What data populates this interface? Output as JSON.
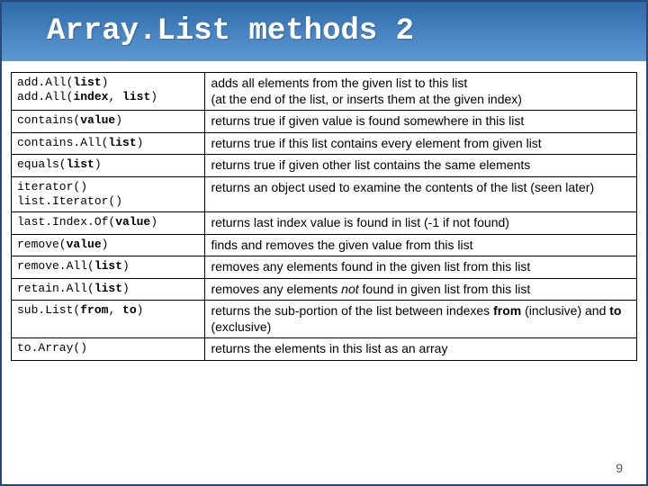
{
  "title_part1": "Array.List",
  "title_part2": " methods 2",
  "page_number": "9",
  "rows": [
    {
      "sig_html": "add.All(<b>list</b>)<br>add.All(<b>index</b>, <b>list</b>)",
      "desc_html": "adds all elements from the given list to this list<br>(at the end of the list, or inserts them at the given index)"
    },
    {
      "sig_html": "contains(<b>value</b>)",
      "desc_html": "returns true if given value is found somewhere in this list"
    },
    {
      "sig_html": "contains.All(<b>list</b>)",
      "desc_html": "returns true if this list contains every element from given list"
    },
    {
      "sig_html": "equals(<b>list</b>)",
      "desc_html": "returns true if given other list contains the same elements"
    },
    {
      "sig_html": "iterator()<br>list.Iterator()",
      "desc_html": "returns an object used to examine the contents of the list (seen later)"
    },
    {
      "sig_html": "last.Index.Of(<b>value</b>)",
      "desc_html": "returns last index value is found in list (-1 if not found)"
    },
    {
      "sig_html": "remove(<b>value</b>)",
      "desc_html": "finds and removes the given value from this list"
    },
    {
      "sig_html": "remove.All(<b>list</b>)",
      "desc_html": "removes any elements found in the given list from this list"
    },
    {
      "sig_html": "retain.All(<b>list</b>)",
      "desc_html": "removes any elements <em class='not'>not</em> found in given list from this list"
    },
    {
      "sig_html": "sub.List(<b>from</b>, <b>to</b>)",
      "desc_html": "returns the sub-portion of the list between indexes <b>from</b> (inclusive) and <b>to</b> (exclusive)"
    },
    {
      "sig_html": "to.Array()",
      "desc_html": "returns the elements in this list as an array"
    }
  ]
}
